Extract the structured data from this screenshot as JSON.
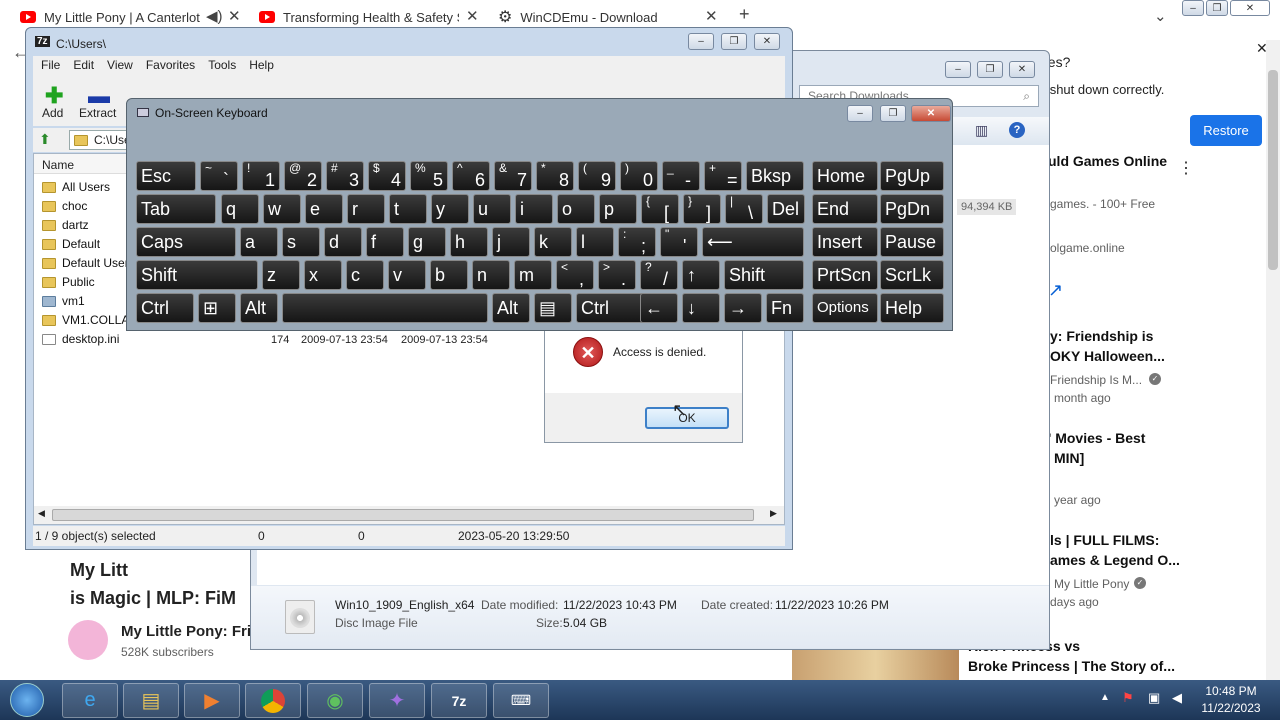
{
  "browser": {
    "tabs": [
      {
        "label": "My Little Pony | A Canterlot"
      },
      {
        "label": "Transforming Health & Safety Se"
      },
      {
        "label": "WinCDEmu - Download"
      }
    ]
  },
  "notify": {
    "text1": "ges?",
    "text2": "'t shut down correctly.",
    "restore": "Restore"
  },
  "youtube": {
    "side": [
      "games. - 100+ Free",
      "olgame.online",
      "y: Friendship is",
      "OKY Halloween...",
      "Friendship Is M...",
      "month ago",
      "' Movies - Best",
      "MIN]",
      "year ago",
      "ls | FULL FILMS:",
      "ames & Legend O...",
      "My Little Pony",
      "days ago",
      "Rich Princess vs",
      "Broke Princess | The Story of..."
    ],
    "side_top": "uld Games Online",
    "main_title1": "My Litt",
    "main_title2": "is Magic | MLP: FiM",
    "channel": "My Little Pony: Fri",
    "subs": "528K subscribers"
  },
  "zip": {
    "title": "C:\\Users\\",
    "menu": [
      "File",
      "Edit",
      "View",
      "Favorites",
      "Tools",
      "Help"
    ],
    "toolbar": {
      "add": "Add",
      "extract": "Extract"
    },
    "path": "C:\\Use",
    "col_name": "Name",
    "files": [
      "All Users",
      "choc",
      "dartz",
      "Default",
      "Default User",
      "Public",
      "vm1",
      "VM1.COLLAB",
      "desktop.ini"
    ],
    "ini_size": "174",
    "ini_mod": "2009-07-13 23:54",
    "ini_created": "2009-07-13 23:54",
    "status": {
      "sel": "1 / 9 object(s) selected",
      "a": "0",
      "b": "0",
      "date": "2023-05-20 13:29:50"
    }
  },
  "osk": {
    "title": "On-Screen Keyboard"
  },
  "dialog": {
    "message": "Access is denied.",
    "ok": "OK"
  },
  "downloads": {
    "search": "Search Downloads",
    "size_badge": "94,394 KB",
    "file": {
      "name": "Win10_1909_English_x64",
      "type": "Disc Image File",
      "mod_label": "Date modified:",
      "mod": "11/22/2023 10:43 PM",
      "created_label": "Date created:",
      "created": "11/22/2023 10:26 PM",
      "size_label": "Size:",
      "size": "5.04 GB"
    }
  },
  "taskbar": {
    "time": "10:48 PM",
    "date": "11/22/2023"
  }
}
